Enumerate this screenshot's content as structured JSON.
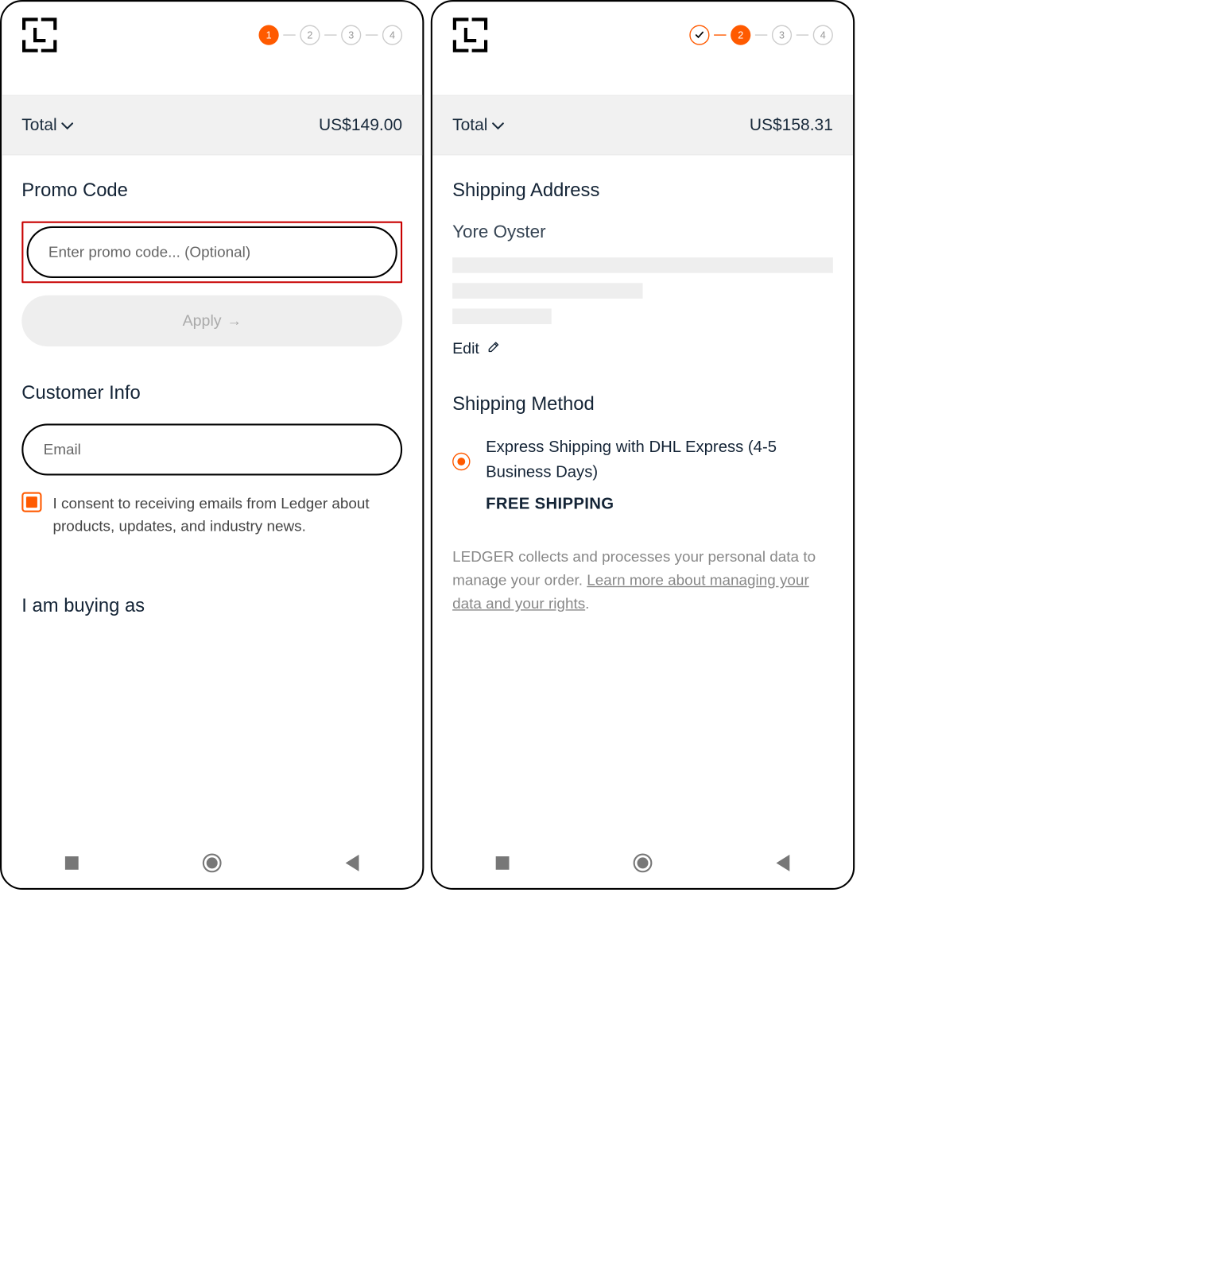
{
  "left": {
    "steps": [
      "1",
      "2",
      "3",
      "4"
    ],
    "active_step": 1,
    "total_label": "Total",
    "total_amount": "US$149.00",
    "promo_heading": "Promo Code",
    "promo_placeholder": "Enter promo code... (Optional)",
    "apply_label": "Apply",
    "customer_heading": "Customer Info",
    "email_placeholder": "Email",
    "consent_text": "I consent to receiving emails from Ledger about products, updates, and industry news.",
    "buying_heading": "I am buying as"
  },
  "right": {
    "steps": [
      "✓",
      "2",
      "3",
      "4"
    ],
    "active_step": 2,
    "total_label": "Total",
    "total_amount": "US$158.31",
    "address_heading": "Shipping Address",
    "address_name": "Yore Oyster",
    "edit_label": "Edit",
    "method_heading": "Shipping Method",
    "shipping_option": "Express Shipping with DHL Express (4-5 Business Days)",
    "shipping_free": "FREE SHIPPING",
    "legal_prefix": "LEDGER collects and processes your personal data to manage your order. ",
    "legal_link": "Learn more about managing your data and your rights",
    "legal_suffix": "."
  }
}
